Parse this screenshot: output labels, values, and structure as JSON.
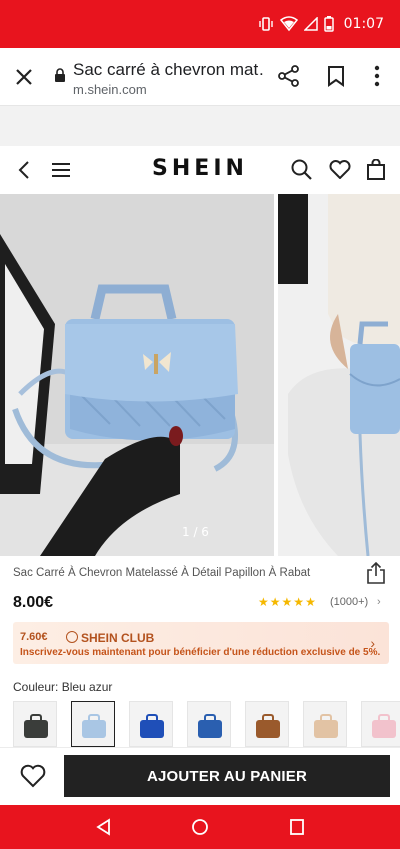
{
  "status_bar": {
    "time": "01:07",
    "accent": "#e8141e"
  },
  "browser": {
    "page_title": "Sac carré à chevron mat…",
    "domain": "m.shein.com"
  },
  "shop": {
    "logo": "SHEIN"
  },
  "gallery": {
    "counter": "1 / 6"
  },
  "product": {
    "title": "Sac Carré À Chevron Matelassé À Détail Papillon À Rabat",
    "price": "8.00€",
    "rating": 5,
    "review_count": "(1000+)"
  },
  "club": {
    "price": "7.60€",
    "name": "SHEIN CLUB",
    "description": "Inscrivez-vous maintenant pour bénéficier d'une réduction exclusive de 5%."
  },
  "color": {
    "label": "Couleur: Bleu azur",
    "swatches": [
      {
        "color": "#3a3d3a",
        "selected": false
      },
      {
        "color": "#a9c6e4",
        "selected": true
      },
      {
        "color": "#1f4fb8",
        "selected": false
      },
      {
        "color": "#2a5fb0",
        "selected": false
      },
      {
        "color": "#9a5a2c",
        "selected": false
      },
      {
        "color": "#e2c3a4",
        "selected": false
      },
      {
        "color": "#f2c2cc",
        "selected": false
      }
    ]
  },
  "actions": {
    "add_to_cart": "AJOUTER AU PANIER"
  }
}
